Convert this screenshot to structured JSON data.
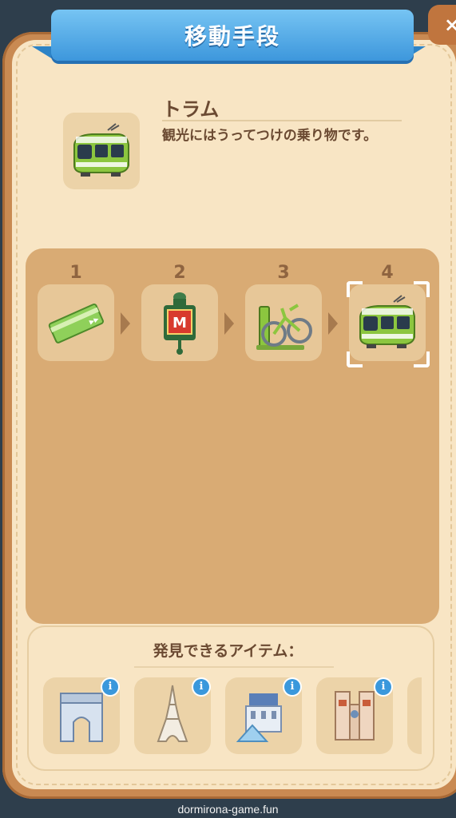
{
  "title": "移動手段",
  "close_label": "×",
  "transport": {
    "name": "トラム",
    "description": "観光にはうってつけの乗り物です。",
    "icon": "tram-icon"
  },
  "steps": [
    {
      "number": "1",
      "icon": "ticket-icon"
    },
    {
      "number": "2",
      "icon": "metro-sign-icon"
    },
    {
      "number": "3",
      "icon": "bicycle-icon"
    },
    {
      "number": "4",
      "icon": "tram-icon",
      "selected": true
    }
  ],
  "items_section": {
    "title": "発見できるアイテム：",
    "info_label": "i",
    "items": [
      {
        "icon": "arc-de-triomphe-icon"
      },
      {
        "icon": "eiffel-tower-icon"
      },
      {
        "icon": "louvre-icon"
      },
      {
        "icon": "notre-dame-icon"
      }
    ]
  },
  "watermark": "dormirona-game.fun",
  "colors": {
    "ribbon": "#3d97dc",
    "panel_frame": "#c98a52",
    "panel_fill": "#f8e5c4",
    "steps_area": "#d9ab74",
    "text_brown": "#6b4a32",
    "tram_green": "#8cc63f"
  }
}
